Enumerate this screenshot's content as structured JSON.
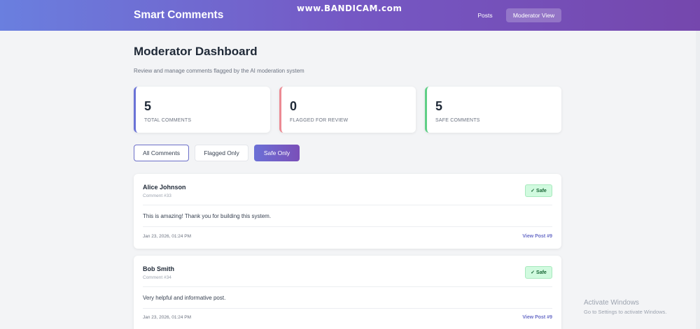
{
  "header": {
    "brand": "Smart Comments",
    "watermark": "www.BANDICAM.com",
    "nav": {
      "posts": "Posts",
      "moderator": "Moderator View"
    }
  },
  "page": {
    "title": "Moderator Dashboard",
    "subtitle": "Review and manage comments flagged by the AI moderation system"
  },
  "stats": [
    {
      "value": "5",
      "label": "TOTAL COMMENTS"
    },
    {
      "value": "0",
      "label": "FLAGGED FOR REVIEW"
    },
    {
      "value": "5",
      "label": "SAFE COMMENTS"
    }
  ],
  "filters": {
    "all": "All Comments",
    "flagged": "Flagged Only",
    "safe": "Safe Only",
    "active": "Safe Only"
  },
  "comments": [
    {
      "author": "Alice Johnson",
      "id": "Comment #33",
      "status": "Safe",
      "status_icon": "check-icon",
      "text": "This is amazing! Thank you for building this system.",
      "date": "Jan 23, 2026, 01:24 PM",
      "link": "View Post #9"
    },
    {
      "author": "Bob Smith",
      "id": "Comment #34",
      "status": "Safe",
      "status_icon": "check-icon",
      "text": "Very helpful and informative post.",
      "date": "Jan 23, 2026, 01:24 PM",
      "link": "View Post #9"
    }
  ],
  "os_overlay": {
    "title": "Activate Windows",
    "message": "Go to Settings to activate Windows."
  },
  "colors": {
    "header_start": "#6a7fdf",
    "header_end": "#7547ad",
    "total_accent": "#6a72d6",
    "flagged_accent": "#ec8a93",
    "safe_accent": "#5fcf86",
    "safe_badge_bg": "#d1fadf",
    "link": "#6b6fc8"
  }
}
